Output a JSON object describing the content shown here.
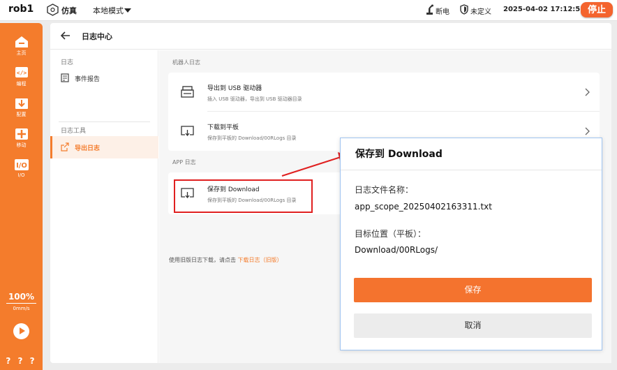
{
  "topbar": {
    "robot_name": "rob1",
    "sim_label": "仿真",
    "mode_label": "本地模式",
    "power_label": "断电",
    "undefined_label": "未定义",
    "datetime": "2025-04-02 17:12:52",
    "stop_label": "停止"
  },
  "leftnav": {
    "items": [
      {
        "label": "主页",
        "icon": "home-icon"
      },
      {
        "label": "编程",
        "icon": "code-icon"
      },
      {
        "label": "配置",
        "icon": "config-icon"
      },
      {
        "label": "移动",
        "icon": "move-icon"
      },
      {
        "label": "I/O",
        "icon": "io-icon"
      }
    ],
    "speed_value": "100%",
    "speed_unit": "0mm/s",
    "help": "? ? ?"
  },
  "page": {
    "title": "日志中心"
  },
  "side": {
    "section_logs": "日志",
    "item_event_report": "事件报告",
    "section_tools": "日志工具",
    "item_export_logs": "导出日志"
  },
  "content": {
    "robot_logs_label": "机器人日志",
    "usb_title": "导出到 USB 驱动器",
    "usb_sub": "插入 USB 驱动器，导出到 USB 驱动器目录",
    "tablet_title": "下载到平板",
    "tablet_sub": "保存到平板的 Download/00RLogs 目录",
    "app_logs_label": "APP 日志",
    "save_title": "保存到 Download",
    "save_sub": "保存到平板的 Download/00RLogs 目录",
    "legacy_text": "使用旧版日志下载，请点击",
    "legacy_link": "下载日志（旧版）"
  },
  "dialog": {
    "title": "保存到 Download",
    "filename_label": "日志文件名称：",
    "filename_value": "app_scope_20250402163311.txt",
    "target_label": "目标位置（平板）：",
    "target_value": "Download/00RLogs/",
    "save_button": "保存",
    "cancel_button": "取消"
  },
  "colors": {
    "accent": "#f47c2c",
    "highlight": "#e02020",
    "dialog_border": "#9ec3f0"
  }
}
